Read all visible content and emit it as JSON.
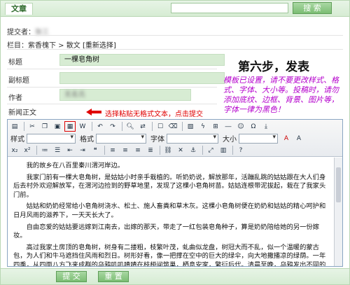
{
  "header": {
    "tab_label": "文章",
    "search_value": "",
    "search_button": "搜 索"
  },
  "meta": {
    "submitter_label": "提交者：",
    "submitter_value": "张三",
    "column_label": "栏目：",
    "column_path": "紫香槐下 > 散文",
    "reselect_link": "[重新选择]"
  },
  "form": {
    "title_label": "标题",
    "title_value": "一棵皂角树",
    "subtitle_label": "副标题",
    "subtitle_value": "",
    "author_label": "作者",
    "author_value": "无名氏",
    "body_label": "新闻正文"
  },
  "step": {
    "title": "第六步，发表",
    "note": "模板已设置，请不要更改样式、格式、字体、大小等。投稿时，请勿添加底纹、边框、背景、图片等，字体一律为黑色！",
    "hint": "选择粘贴无格式文本，点击提交"
  },
  "editor": {
    "style_label": "样式",
    "format_label": "格式",
    "font_label": "字体",
    "size_label": "大小",
    "paragraphs": [
      "我的故乡在八百里秦川渭河岸边。",
      "我家门前有一棵大皂角树，是姑姑小时亲手栽植的。听奶奶说，解放那年，活蹦乱跳的姑姑跟在大人们身后去村外欢迎解放军，在渭河边捡到的野草地里，发现了这棵小皂角树苗。姑姑连根带泥拔起，栽在了我家头门前。",
      "姑姑和奶奶经常给小皂角树浇水、松土、施人畜粪和草木灰。这棵小皂角树便在奶奶和姑姑的精心呵护和日月风雨的滋养下，一天天长大了。",
      "自由恋爱的姑姑要远嫁到江南去，出嫁的那天，带走了一红包装皂角种子，算是奶奶陪给她的另一份嫁妆。",
      "高过我家土房顶的皂角树，树身有二搂粗，枝繁叶茂，虬曲似龙盘，树冠大而不乱，似一个温暖的蒙古包，为人们和牛马遮挡住风雨和烈日。树形好看，像一把撑在空中的巨大的绿伞，向大地撒播凉的绿荫。一年四季，从四面八方飞来成群的乌鸦叽叽喳喳在枝桠间筑巢，栖息安家，繁衍后代。清晨至晚，乌鸦发出不同的音色和谐鸣唱，婉转美妙，似天籁簇音，令人痴迷。皂角树仿佛成了一个大琴台，吸引来着许多飞虫栖息的安乐园。村子里的孩子们成了人们最快活的活动场所。孩子"
    ]
  },
  "footer": {
    "submit_button": "提 交",
    "reset_button": "重 置"
  }
}
